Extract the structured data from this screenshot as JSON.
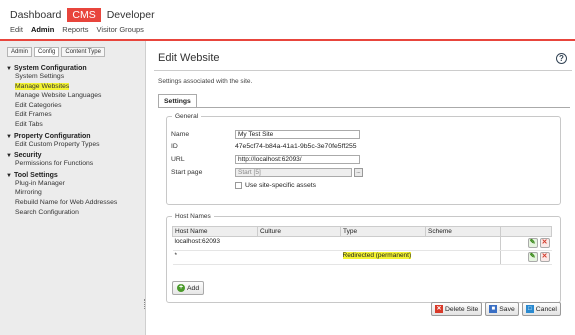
{
  "topnav": {
    "dashboard": "Dashboard",
    "cms": "CMS",
    "developer": "Developer"
  },
  "subnav": {
    "edit": "Edit",
    "admin": "Admin",
    "reports": "Reports",
    "visitor_groups": "Visitor Groups"
  },
  "sidebar": {
    "tabs": [
      "Admin",
      "Config",
      "Content Type"
    ],
    "groups": [
      {
        "title": "System Configuration",
        "items": [
          "System Settings",
          "Manage Websites",
          "Manage Website Languages",
          "Edit Categories",
          "Edit Frames",
          "Edit Tabs"
        ]
      },
      {
        "title": "Property Configuration",
        "items": [
          "Edit Custom Property Types"
        ]
      },
      {
        "title": "Security",
        "items": [
          "Permissions for Functions"
        ]
      },
      {
        "title": "Tool Settings",
        "items": [
          "Plug-in Manager",
          "Mirroring",
          "Rebuild Name for Web Addresses",
          "Search Configuration"
        ]
      }
    ]
  },
  "page": {
    "title": "Edit Website",
    "help": "?",
    "description": "Settings associated with the site.",
    "tab": "Settings"
  },
  "general": {
    "legend": "General",
    "name_label": "Name",
    "name_value": "My Test Site",
    "id_label": "ID",
    "id_value": "47e5cf74-b84a-41a1-9b5c-3e70fe5ff255",
    "url_label": "URL",
    "url_value": "http://localhost:62093/",
    "start_label": "Start page",
    "start_value": "Start [5]",
    "start_pick": "...",
    "site_assets_label": "Use site-specific assets"
  },
  "hosts": {
    "legend": "Host Names",
    "headers": [
      "Host Name",
      "Culture",
      "Type",
      "Scheme"
    ],
    "rows": [
      {
        "host": "localhost:62093",
        "culture": "",
        "type": "",
        "scheme": ""
      },
      {
        "host": "*",
        "culture": "",
        "type": "Redirected (permanent)",
        "scheme": ""
      }
    ],
    "add_label": "Add"
  },
  "actions": {
    "delete": "Delete Site",
    "save": "Save",
    "cancel": "Cancel"
  },
  "colors": {
    "accent": "#e8453c",
    "highlight": "#f4f432"
  }
}
